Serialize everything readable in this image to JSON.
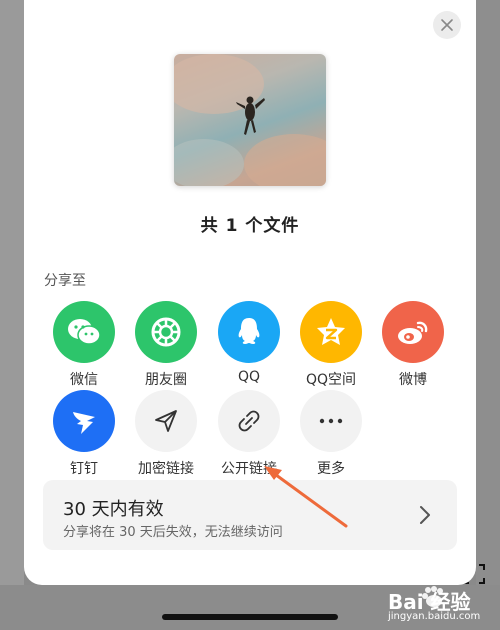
{
  "dialog": {
    "file_count": "共 1 个文件",
    "share_to_label": "分享至"
  },
  "share_row1": [
    {
      "label": "微信",
      "icon": "wechat-icon",
      "color": "#2dc56b"
    },
    {
      "label": "朋友圈",
      "icon": "moments-icon",
      "color": "#2dc56b"
    },
    {
      "label": "QQ",
      "icon": "qq-icon",
      "color": "#1aa7f5"
    },
    {
      "label": "QQ空间",
      "icon": "qzone-icon",
      "color": "#ffb700"
    },
    {
      "label": "微博",
      "icon": "weibo-icon",
      "color": "#f0644a"
    }
  ],
  "share_row2": [
    {
      "label": "钉钉",
      "icon": "dingtalk-icon",
      "color": "#1e6ff5"
    },
    {
      "label": "加密链接",
      "icon": "send-icon",
      "color": "#f2f2f2"
    },
    {
      "label": "公开链接",
      "icon": "link-icon",
      "color": "#f2f2f2"
    },
    {
      "label": "更多",
      "icon": "more-icon",
      "color": "#f2f2f2"
    }
  ],
  "validity": {
    "title": "30 天内有效",
    "subtitle": "分享将在 30 天后失效，无法继续访问"
  },
  "watermark": {
    "brand": "Bai 经验",
    "url": "jingyan.baidu.com"
  }
}
